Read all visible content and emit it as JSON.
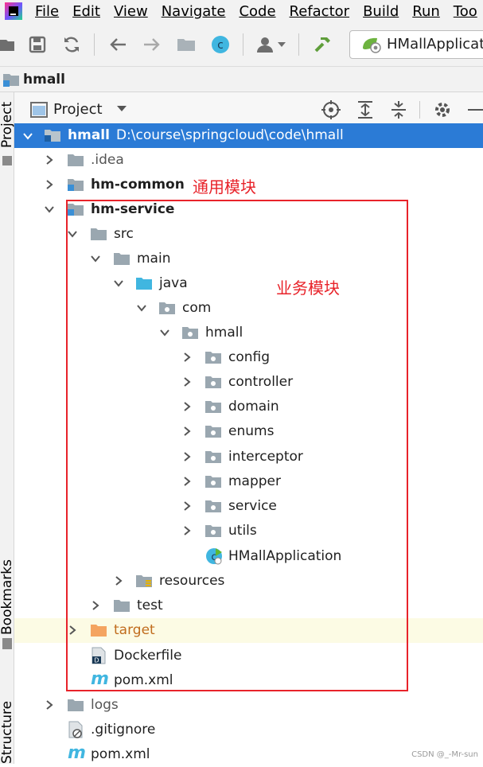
{
  "menu": [
    "File",
    "Edit",
    "View",
    "Navigate",
    "Code",
    "Refactor",
    "Build",
    "Run",
    "Too"
  ],
  "toolbar": {
    "run_config": "HMallApplicatio",
    "icons": [
      "open-folder-icon",
      "save-icon",
      "sync-icon",
      "back-icon",
      "forward-icon",
      "folder-icon",
      "class-icon",
      "user-icon",
      "build-hammer-icon",
      "spring-run-icon"
    ]
  },
  "navbar": {
    "project": "hmall"
  },
  "side_tabs": {
    "project": "Project",
    "bookmarks": "Bookmarks",
    "structure": "Structure"
  },
  "panel": {
    "title": "Project"
  },
  "tree": {
    "root": {
      "name": "hmall",
      "path": "D:\\course\\springcloud\\code\\hmall"
    },
    "idea": ".idea",
    "hm_common": "hm-common",
    "hm_service": "hm-service",
    "src": "src",
    "main": "main",
    "java": "java",
    "com": "com",
    "hmall": "hmall",
    "packages": [
      "config",
      "controller",
      "domain",
      "enums",
      "interceptor",
      "mapper",
      "service",
      "utils"
    ],
    "app_class": "HMallApplication",
    "resources": "resources",
    "test": "test",
    "target": "target",
    "dockerfile": "Dockerfile",
    "service_pom": "pom.xml",
    "logs": "logs",
    "gitignore": ".gitignore",
    "root_pom": "pom.xml"
  },
  "annotations": {
    "common": "通用模块",
    "business": "业务模块"
  },
  "watermark": "CSDN @_-Mr-sun",
  "colors": {
    "selection": "#2b7bd6",
    "annotation": "#e8232a",
    "folder": "#9aa7b0",
    "source_folder": "#40b6e0",
    "excluded_folder": "#f4a460"
  }
}
